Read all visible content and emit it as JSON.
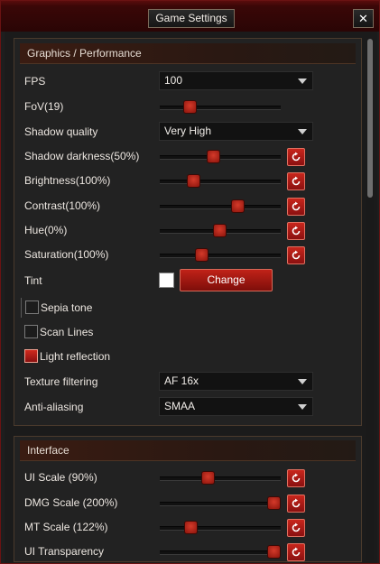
{
  "window": {
    "title": "Game Settings",
    "close_glyph": "✕"
  },
  "graphics": {
    "header": "Graphics / Performance",
    "fps": {
      "label": "FPS",
      "value": "100"
    },
    "fov": {
      "label": "FoV(19)",
      "value": 0.25
    },
    "shadow_quality": {
      "label": "Shadow quality",
      "value": "Very High"
    },
    "shadow_darkness": {
      "label": "Shadow darkness(50%)",
      "value": 0.45
    },
    "brightness": {
      "label": "Brightness(100%)",
      "value": 0.28
    },
    "contrast": {
      "label": "Contrast(100%)",
      "value": 0.65
    },
    "hue": {
      "label": "Hue(0%)",
      "value": 0.5
    },
    "saturation": {
      "label": "Saturation(100%)",
      "value": 0.35
    },
    "tint": {
      "label": "Tint",
      "color": "#ffffff",
      "button": "Change"
    },
    "sepia": {
      "label": "Sepia tone",
      "checked": false
    },
    "scan_lines": {
      "label": "Scan Lines",
      "checked": false
    },
    "light_reflection": {
      "label": "Light reflection",
      "checked": true
    },
    "texture_filtering": {
      "label": "Texture filtering",
      "value": "AF 16x"
    },
    "anti_aliasing": {
      "label": "Anti-aliasing",
      "value": "SMAA"
    }
  },
  "interface": {
    "header": "Interface",
    "ui_scale": {
      "label": "UI Scale (90%)",
      "value": 0.4
    },
    "dmg_scale": {
      "label": "DMG Scale (200%)",
      "value": 0.95
    },
    "mt_scale": {
      "label": "MT Scale (122%)",
      "value": 0.26
    },
    "ui_transparency": {
      "label": "UI Transparency",
      "value": 0.95
    }
  },
  "icons": {
    "reset": "reset-icon",
    "dropdown": "chevron-down-icon",
    "close": "close-icon"
  },
  "colors": {
    "accent": "#b01c14",
    "frame": "#5a0c0c",
    "panel": "#222222"
  }
}
